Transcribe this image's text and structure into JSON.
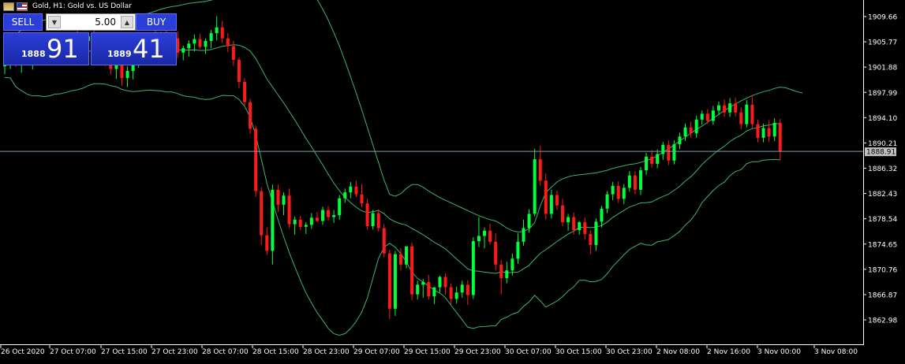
{
  "window": {
    "title": "Gold, H1:  Gold vs. US Dollar"
  },
  "trade_panel": {
    "sell_label": "SELL",
    "buy_label": "BUY",
    "lot_value": "5.00",
    "sell_price_small": "1888",
    "sell_price_big": "91",
    "buy_price_small": "1889",
    "buy_price_big": "41"
  },
  "colors": {
    "background": "#000000",
    "bull_candle": "#00ff3c",
    "bear_candle": "#ff1a1a",
    "bollinger": "#3cb371",
    "price_line": "#7aa0b8",
    "axis": "#ffffff",
    "current_price_label_bg": "#c0c0c0"
  },
  "chart_data": {
    "type": "candlestick",
    "symbol": "Gold",
    "timeframe": "H1",
    "indicator": "Bollinger Bands",
    "current_price": 1888.91,
    "current_price_label": "1888.91",
    "y_ticks": [
      "1909.66",
      "1905.77",
      "1901.88",
      "1897.99",
      "1894.10",
      "1890.21",
      "1886.32",
      "1882.43",
      "1878.54",
      "1874.65",
      "1870.76",
      "1866.87",
      "1862.98"
    ],
    "x_tick_labels": [
      "26 Oct 2020",
      "27 Oct 07:00",
      "27 Oct 15:00",
      "27 Oct 23:00",
      "28 Oct 07:00",
      "28 Oct 15:00",
      "28 Oct 23:00",
      "29 Oct 07:00",
      "29 Oct 15:00",
      "29 Oct 23:00",
      "30 Oct 07:00",
      "30 Oct 15:00",
      "30 Oct 23:00",
      "2 Nov 08:00",
      "2 Nov 16:00",
      "3 Nov 00:00",
      "3 Nov 08:00"
    ],
    "ohlc": [
      [
        1902.0,
        1903.5,
        1900.8,
        1902.9
      ],
      [
        1902.9,
        1904.0,
        1901.6,
        1903.4
      ],
      [
        1903.4,
        1904.2,
        1901.9,
        1902.3
      ],
      [
        1902.3,
        1903.8,
        1901.0,
        1903.1
      ],
      [
        1903.1,
        1904.6,
        1902.2,
        1902.8
      ],
      [
        1902.8,
        1904.0,
        1901.5,
        1903.6
      ],
      [
        1903.6,
        1905.0,
        1902.7,
        1904.2
      ],
      [
        1904.2,
        1905.5,
        1903.0,
        1903.5
      ],
      [
        1903.5,
        1905.0,
        1902.4,
        1904.6
      ],
      [
        1904.6,
        1906.1,
        1903.8,
        1905.2
      ],
      [
        1905.2,
        1906.7,
        1904.1,
        1904.4
      ],
      [
        1904.4,
        1905.8,
        1903.0,
        1905.5
      ],
      [
        1905.5,
        1907.0,
        1904.5,
        1906.1
      ],
      [
        1906.1,
        1907.5,
        1905.0,
        1905.0
      ],
      [
        1905.0,
        1906.4,
        1903.8,
        1905.9
      ],
      [
        1905.9,
        1907.2,
        1904.7,
        1906.6
      ],
      [
        1906.6,
        1907.9,
        1905.5,
        1905.8
      ],
      [
        1905.8,
        1907.0,
        1903.9,
        1904.5
      ],
      [
        1904.5,
        1905.9,
        1902.0,
        1903.0
      ],
      [
        1903.0,
        1904.2,
        1900.8,
        1901.6
      ],
      [
        1901.6,
        1903.0,
        1900.1,
        1902.5
      ],
      [
        1902.5,
        1903.8,
        1899.0,
        1900.2
      ],
      [
        1900.2,
        1902.0,
        1898.8,
        1901.3
      ],
      [
        1901.3,
        1903.1,
        1900.0,
        1902.9
      ],
      [
        1902.9,
        1904.8,
        1901.8,
        1904.3
      ],
      [
        1904.3,
        1906.0,
        1903.1,
        1905.6
      ],
      [
        1905.6,
        1907.1,
        1904.5,
        1906.8
      ],
      [
        1906.8,
        1908.0,
        1905.4,
        1906.0
      ],
      [
        1906.0,
        1907.3,
        1904.6,
        1907.0
      ],
      [
        1907.0,
        1908.3,
        1905.2,
        1905.5
      ],
      [
        1905.5,
        1906.8,
        1904.0,
        1906.3
      ],
      [
        1906.3,
        1907.4,
        1903.3,
        1904.1
      ],
      [
        1904.1,
        1905.2,
        1902.9,
        1904.8
      ],
      [
        1904.8,
        1906.0,
        1903.5,
        1905.5
      ],
      [
        1905.5,
        1906.9,
        1904.3,
        1906.2
      ],
      [
        1906.2,
        1907.0,
        1904.7,
        1905.0
      ],
      [
        1905.0,
        1906.3,
        1903.9,
        1905.9
      ],
      [
        1905.9,
        1907.6,
        1904.8,
        1907.1
      ],
      [
        1907.1,
        1909.7,
        1906.0,
        1908.0
      ],
      [
        1908.0,
        1909.0,
        1905.6,
        1906.3
      ],
      [
        1906.3,
        1907.1,
        1904.2,
        1905.1
      ],
      [
        1905.1,
        1905.9,
        1902.1,
        1903.0
      ],
      [
        1903.0,
        1903.4,
        1898.6,
        1899.6
      ],
      [
        1899.6,
        1900.2,
        1895.9,
        1896.5
      ],
      [
        1896.5,
        1897.0,
        1891.6,
        1892.4
      ],
      [
        1892.4,
        1892.9,
        1881.9,
        1882.8
      ],
      [
        1882.8,
        1883.4,
        1874.5,
        1876.0
      ],
      [
        1876.0,
        1877.2,
        1873.0,
        1873.6
      ],
      [
        1873.6,
        1883.8,
        1871.5,
        1883.0
      ],
      [
        1883.0,
        1883.8,
        1879.6,
        1880.7
      ],
      [
        1880.7,
        1882.6,
        1879.1,
        1882.1
      ],
      [
        1882.1,
        1883.2,
        1877.1,
        1877.7
      ],
      [
        1877.7,
        1878.9,
        1876.1,
        1878.4
      ],
      [
        1878.4,
        1879.0,
        1876.8,
        1877.3
      ],
      [
        1877.3,
        1878.0,
        1876.2,
        1877.6
      ],
      [
        1877.6,
        1879.4,
        1877.0,
        1878.7
      ],
      [
        1878.7,
        1879.6,
        1878.0,
        1878.2
      ],
      [
        1878.2,
        1880.4,
        1877.6,
        1879.9
      ],
      [
        1879.9,
        1880.5,
        1878.3,
        1878.8
      ],
      [
        1878.8,
        1879.9,
        1877.9,
        1879.1
      ],
      [
        1879.1,
        1882.2,
        1878.4,
        1881.7
      ],
      [
        1881.7,
        1883.2,
        1881.0,
        1882.6
      ],
      [
        1882.6,
        1884.2,
        1881.7,
        1883.5
      ],
      [
        1883.5,
        1884.4,
        1881.9,
        1882.3
      ],
      [
        1882.3,
        1883.9,
        1880.3,
        1880.9
      ],
      [
        1880.9,
        1881.6,
        1876.9,
        1877.4
      ],
      [
        1877.4,
        1879.9,
        1876.9,
        1879.4
      ],
      [
        1879.4,
        1880.0,
        1876.6,
        1877.1
      ],
      [
        1877.1,
        1877.7,
        1872.6,
        1873.2
      ],
      [
        1873.2,
        1873.8,
        1863.1,
        1864.7
      ],
      [
        1864.7,
        1873.6,
        1863.6,
        1873.1
      ],
      [
        1873.1,
        1874.0,
        1870.6,
        1871.5
      ],
      [
        1871.5,
        1874.2,
        1870.9,
        1874.3
      ],
      [
        1874.3,
        1874.9,
        1866.0,
        1866.9
      ],
      [
        1866.9,
        1869.0,
        1866.1,
        1868.4
      ],
      [
        1868.4,
        1869.3,
        1866.4,
        1868.8
      ],
      [
        1868.8,
        1869.9,
        1866.1,
        1866.6
      ],
      [
        1866.6,
        1867.4,
        1865.4,
        1868.0
      ],
      [
        1868.0,
        1869.8,
        1867.2,
        1869.6
      ],
      [
        1869.6,
        1870.1,
        1866.9,
        1868.0
      ],
      [
        1868.0,
        1868.6,
        1865.3,
        1866.2
      ],
      [
        1866.2,
        1868.1,
        1865.5,
        1867.2
      ],
      [
        1867.2,
        1869.0,
        1866.4,
        1868.4
      ],
      [
        1868.4,
        1869.1,
        1865.3,
        1866.8
      ],
      [
        1866.8,
        1875.7,
        1866.2,
        1875.1
      ],
      [
        1875.1,
        1878.8,
        1874.2,
        1875.9
      ],
      [
        1875.9,
        1877.2,
        1874.0,
        1876.7
      ],
      [
        1876.7,
        1877.8,
        1874.6,
        1875.0
      ],
      [
        1875.0,
        1876.3,
        1870.6,
        1871.5
      ],
      [
        1871.5,
        1872.2,
        1866.9,
        1869.4
      ],
      [
        1869.4,
        1871.9,
        1868.6,
        1870.6
      ],
      [
        1870.6,
        1873.2,
        1869.8,
        1872.4
      ],
      [
        1872.4,
        1876.3,
        1871.6,
        1875.0
      ],
      [
        1875.0,
        1878.4,
        1874.4,
        1877.1
      ],
      [
        1877.1,
        1880.0,
        1876.4,
        1879.3
      ],
      [
        1879.3,
        1889.3,
        1878.9,
        1887.7
      ],
      [
        1887.7,
        1889.8,
        1883.6,
        1884.4
      ],
      [
        1884.4,
        1885.5,
        1878.4,
        1879.3
      ],
      [
        1879.3,
        1883.0,
        1878.6,
        1882.2
      ],
      [
        1882.2,
        1882.9,
        1879.9,
        1880.6
      ],
      [
        1880.6,
        1881.6,
        1877.4,
        1878.0
      ],
      [
        1878.0,
        1879.3,
        1876.7,
        1878.8
      ],
      [
        1878.8,
        1879.5,
        1876.1,
        1876.8
      ],
      [
        1876.8,
        1878.2,
        1876.1,
        1878.0
      ],
      [
        1878.0,
        1878.7,
        1875.3,
        1876.2
      ],
      [
        1876.2,
        1876.8,
        1873.1,
        1874.5
      ],
      [
        1874.5,
        1878.6,
        1873.6,
        1878.1
      ],
      [
        1878.1,
        1880.5,
        1877.2,
        1880.1
      ],
      [
        1880.1,
        1882.8,
        1879.4,
        1882.3
      ],
      [
        1882.3,
        1884.2,
        1881.4,
        1883.6
      ],
      [
        1883.6,
        1884.3,
        1881.0,
        1881.6
      ],
      [
        1881.6,
        1883.9,
        1880.8,
        1883.3
      ],
      [
        1883.3,
        1885.9,
        1882.7,
        1885.2
      ],
      [
        1885.2,
        1885.9,
        1882.3,
        1883.0
      ],
      [
        1883.0,
        1886.5,
        1882.2,
        1886.0
      ],
      [
        1886.0,
        1888.7,
        1885.3,
        1888.1
      ],
      [
        1888.1,
        1889.1,
        1886.4,
        1887.0
      ],
      [
        1887.0,
        1889.2,
        1886.3,
        1888.5
      ],
      [
        1888.5,
        1890.4,
        1887.6,
        1889.9
      ],
      [
        1889.9,
        1890.6,
        1886.8,
        1887.5
      ],
      [
        1887.5,
        1890.6,
        1886.9,
        1890.0
      ],
      [
        1890.0,
        1891.8,
        1889.3,
        1891.2
      ],
      [
        1891.2,
        1893.2,
        1890.5,
        1892.6
      ],
      [
        1892.6,
        1893.5,
        1891.0,
        1891.7
      ],
      [
        1891.7,
        1894.4,
        1891.0,
        1893.8
      ],
      [
        1893.8,
        1895.2,
        1893.0,
        1894.7
      ],
      [
        1894.7,
        1895.4,
        1893.1,
        1893.6
      ],
      [
        1893.6,
        1895.9,
        1893.0,
        1895.2
      ],
      [
        1895.2,
        1896.6,
        1894.5,
        1896.0
      ],
      [
        1896.0,
        1896.9,
        1894.2,
        1894.9
      ],
      [
        1894.9,
        1897.1,
        1894.2,
        1896.3
      ],
      [
        1896.3,
        1897.2,
        1894.3,
        1894.9
      ],
      [
        1894.9,
        1895.7,
        1892.3,
        1893.1
      ],
      [
        1893.1,
        1896.8,
        1892.6,
        1896.1
      ],
      [
        1896.1,
        1897.6,
        1892.4,
        1893.1
      ],
      [
        1893.1,
        1893.8,
        1890.3,
        1891.0
      ],
      [
        1891.0,
        1893.2,
        1890.3,
        1892.5
      ],
      [
        1892.5,
        1893.7,
        1890.4,
        1891.2
      ],
      [
        1891.2,
        1894.0,
        1890.5,
        1893.3
      ],
      [
        1893.3,
        1893.9,
        1887.5,
        1888.9
      ]
    ],
    "bb_upper": [
      1905.5,
      1906.1,
      1906.9,
      1907.6,
      1908.1,
      1908.6,
      1908.9,
      1909.1,
      1909.3,
      1909.4,
      1909.5,
      1909.6,
      1909.7,
      1909.7,
      1909.7,
      1909.6,
      1909.5,
      1909.5,
      1909.4,
      1909.4,
      1909.5,
      1909.6,
      1909.7,
      1909.8,
      1909.9,
      1910.0,
      1910.2,
      1910.5,
      1910.8,
      1911.0,
      1911.2,
      1911.3,
      1911.5,
      1911.7,
      1911.8,
      1911.9,
      1912.0,
      1912.2,
      1912.4,
      1912.6,
      1912.9,
      1913.2,
      1913.6,
      1914.0,
      1914.5,
      1915.0,
      1915.6,
      1916.1,
      1916.5,
      1916.8,
      1917.0,
      1916.8,
      1916.3,
      1915.6,
      1914.7,
      1913.6,
      1912.3,
      1910.8,
      1909.1,
      1907.2,
      1905.1,
      1902.8,
      1900.4,
      1897.9,
      1895.3,
      1892.6,
      1889.9,
      1887.2,
      1884.5,
      1882.3,
      1882.0,
      1882.4,
      1883.2,
      1883.8,
      1883.8,
      1883.4,
      1882.8,
      1882.3,
      1881.8,
      1881.4,
      1881.0,
      1880.6,
      1880.2,
      1879.8,
      1879.4,
      1879.0,
      1878.7,
      1878.4,
      1878.2,
      1877.7,
      1877.1,
      1876.7,
      1876.5,
      1876.6,
      1877.0,
      1877.9,
      1880.5,
      1882.6,
      1883.4,
      1884.2,
      1884.7,
      1885.0,
      1885.2,
      1885.3,
      1885.4,
      1885.5,
      1885.6,
      1885.8,
      1886.0,
      1886.3,
      1886.5,
      1886.7,
      1886.9,
      1887.0,
      1887.2,
      1887.5,
      1887.8,
      1888.2,
      1888.8,
      1889.3,
      1889.9,
      1890.5,
      1891.1,
      1891.7,
      1892.3,
      1892.8,
      1893.4,
      1894.0,
      1894.6,
      1895.2,
      1895.7,
      1896.2,
      1896.7,
      1897.1,
      1897.5,
      1897.8,
      1898.1,
      1898.3,
      1898.6,
      1898.8,
      1898.7,
      1898.4,
      1898.1,
      1897.9
    ]
  },
  "x_axis": {
    "label_count": 17
  },
  "y_axis": {
    "label_count": 13
  }
}
